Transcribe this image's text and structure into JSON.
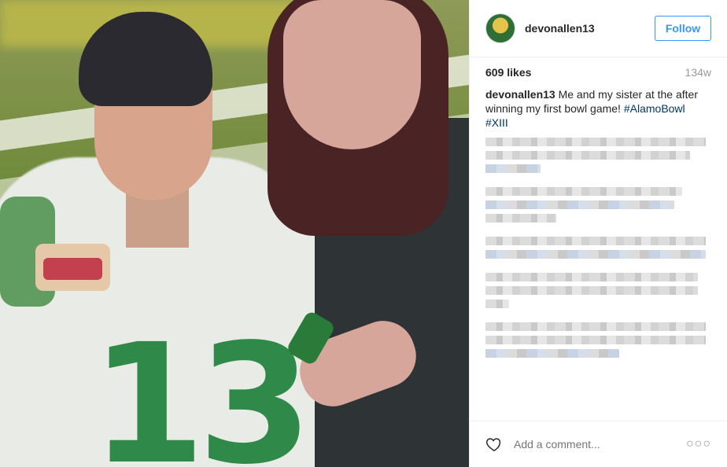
{
  "post": {
    "photo_alt": "",
    "username": "devonallen13",
    "follow_label": "Follow",
    "likes": "609 likes",
    "age": "134w",
    "caption": {
      "user": "devonallen13",
      "text": " Me and my sister at the after winning my first bowl game! ",
      "hashtags": [
        "#AlamoBowl",
        "#XIII"
      ]
    },
    "comment_placeholder": "Add a comment...",
    "more_label": "○○○",
    "icons": {
      "like": "heart-icon",
      "more": "more-options-icon",
      "avatar": "avatar"
    },
    "photo_text": {
      "jersey_number": "13"
    },
    "colors": {
      "accent": "#3897f0",
      "hashtag": "#003569",
      "muted": "#999999"
    }
  }
}
